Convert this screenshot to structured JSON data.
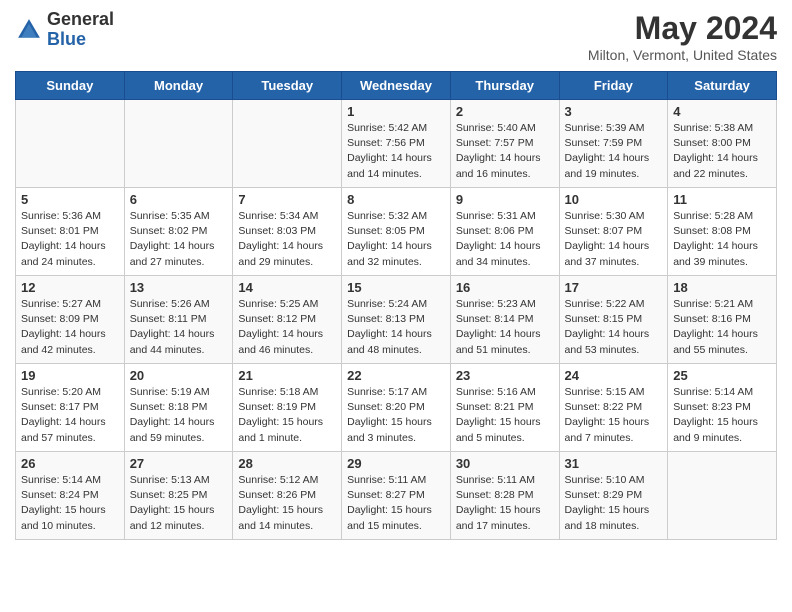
{
  "header": {
    "logo_general": "General",
    "logo_blue": "Blue",
    "title": "May 2024",
    "location": "Milton, Vermont, United States"
  },
  "days_of_week": [
    "Sunday",
    "Monday",
    "Tuesday",
    "Wednesday",
    "Thursday",
    "Friday",
    "Saturday"
  ],
  "weeks": [
    [
      {
        "day": "",
        "info": ""
      },
      {
        "day": "",
        "info": ""
      },
      {
        "day": "",
        "info": ""
      },
      {
        "day": "1",
        "info": "Sunrise: 5:42 AM\nSunset: 7:56 PM\nDaylight: 14 hours\nand 14 minutes."
      },
      {
        "day": "2",
        "info": "Sunrise: 5:40 AM\nSunset: 7:57 PM\nDaylight: 14 hours\nand 16 minutes."
      },
      {
        "day": "3",
        "info": "Sunrise: 5:39 AM\nSunset: 7:59 PM\nDaylight: 14 hours\nand 19 minutes."
      },
      {
        "day": "4",
        "info": "Sunrise: 5:38 AM\nSunset: 8:00 PM\nDaylight: 14 hours\nand 22 minutes."
      }
    ],
    [
      {
        "day": "5",
        "info": "Sunrise: 5:36 AM\nSunset: 8:01 PM\nDaylight: 14 hours\nand 24 minutes."
      },
      {
        "day": "6",
        "info": "Sunrise: 5:35 AM\nSunset: 8:02 PM\nDaylight: 14 hours\nand 27 minutes."
      },
      {
        "day": "7",
        "info": "Sunrise: 5:34 AM\nSunset: 8:03 PM\nDaylight: 14 hours\nand 29 minutes."
      },
      {
        "day": "8",
        "info": "Sunrise: 5:32 AM\nSunset: 8:05 PM\nDaylight: 14 hours\nand 32 minutes."
      },
      {
        "day": "9",
        "info": "Sunrise: 5:31 AM\nSunset: 8:06 PM\nDaylight: 14 hours\nand 34 minutes."
      },
      {
        "day": "10",
        "info": "Sunrise: 5:30 AM\nSunset: 8:07 PM\nDaylight: 14 hours\nand 37 minutes."
      },
      {
        "day": "11",
        "info": "Sunrise: 5:28 AM\nSunset: 8:08 PM\nDaylight: 14 hours\nand 39 minutes."
      }
    ],
    [
      {
        "day": "12",
        "info": "Sunrise: 5:27 AM\nSunset: 8:09 PM\nDaylight: 14 hours\nand 42 minutes."
      },
      {
        "day": "13",
        "info": "Sunrise: 5:26 AM\nSunset: 8:11 PM\nDaylight: 14 hours\nand 44 minutes."
      },
      {
        "day": "14",
        "info": "Sunrise: 5:25 AM\nSunset: 8:12 PM\nDaylight: 14 hours\nand 46 minutes."
      },
      {
        "day": "15",
        "info": "Sunrise: 5:24 AM\nSunset: 8:13 PM\nDaylight: 14 hours\nand 48 minutes."
      },
      {
        "day": "16",
        "info": "Sunrise: 5:23 AM\nSunset: 8:14 PM\nDaylight: 14 hours\nand 51 minutes."
      },
      {
        "day": "17",
        "info": "Sunrise: 5:22 AM\nSunset: 8:15 PM\nDaylight: 14 hours\nand 53 minutes."
      },
      {
        "day": "18",
        "info": "Sunrise: 5:21 AM\nSunset: 8:16 PM\nDaylight: 14 hours\nand 55 minutes."
      }
    ],
    [
      {
        "day": "19",
        "info": "Sunrise: 5:20 AM\nSunset: 8:17 PM\nDaylight: 14 hours\nand 57 minutes."
      },
      {
        "day": "20",
        "info": "Sunrise: 5:19 AM\nSunset: 8:18 PM\nDaylight: 14 hours\nand 59 minutes."
      },
      {
        "day": "21",
        "info": "Sunrise: 5:18 AM\nSunset: 8:19 PM\nDaylight: 15 hours\nand 1 minute."
      },
      {
        "day": "22",
        "info": "Sunrise: 5:17 AM\nSunset: 8:20 PM\nDaylight: 15 hours\nand 3 minutes."
      },
      {
        "day": "23",
        "info": "Sunrise: 5:16 AM\nSunset: 8:21 PM\nDaylight: 15 hours\nand 5 minutes."
      },
      {
        "day": "24",
        "info": "Sunrise: 5:15 AM\nSunset: 8:22 PM\nDaylight: 15 hours\nand 7 minutes."
      },
      {
        "day": "25",
        "info": "Sunrise: 5:14 AM\nSunset: 8:23 PM\nDaylight: 15 hours\nand 9 minutes."
      }
    ],
    [
      {
        "day": "26",
        "info": "Sunrise: 5:14 AM\nSunset: 8:24 PM\nDaylight: 15 hours\nand 10 minutes."
      },
      {
        "day": "27",
        "info": "Sunrise: 5:13 AM\nSunset: 8:25 PM\nDaylight: 15 hours\nand 12 minutes."
      },
      {
        "day": "28",
        "info": "Sunrise: 5:12 AM\nSunset: 8:26 PM\nDaylight: 15 hours\nand 14 minutes."
      },
      {
        "day": "29",
        "info": "Sunrise: 5:11 AM\nSunset: 8:27 PM\nDaylight: 15 hours\nand 15 minutes."
      },
      {
        "day": "30",
        "info": "Sunrise: 5:11 AM\nSunset: 8:28 PM\nDaylight: 15 hours\nand 17 minutes."
      },
      {
        "day": "31",
        "info": "Sunrise: 5:10 AM\nSunset: 8:29 PM\nDaylight: 15 hours\nand 18 minutes."
      },
      {
        "day": "",
        "info": ""
      }
    ]
  ]
}
